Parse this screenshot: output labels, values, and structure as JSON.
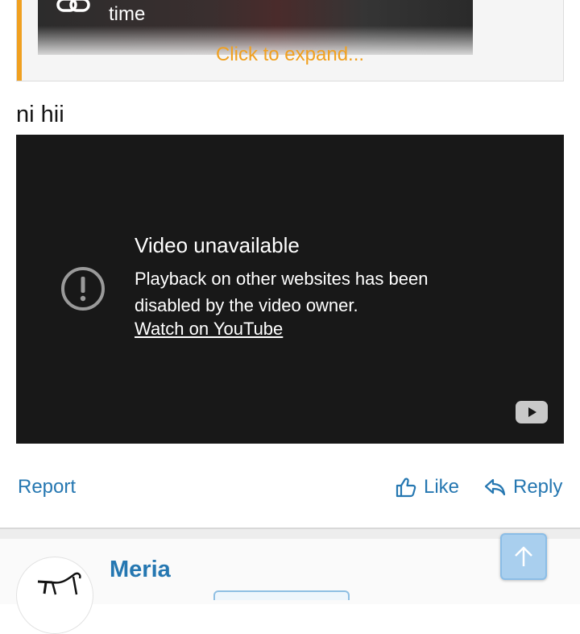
{
  "quote": {
    "embed_text": "time",
    "link_icon": "link-icon",
    "expand_label": "Click to expand...",
    "accent_color": "#f0a020"
  },
  "post": {
    "text": "ni hii"
  },
  "video": {
    "title": "Video unavailable",
    "message": "Playback on other websites has been disabled by the video owner.",
    "link_label": "Watch on YouTube",
    "warning_icon": "exclamation-circle-icon",
    "logo_icon": "youtube-logo-icon"
  },
  "actions": {
    "report_label": "Report",
    "like_label": "Like",
    "reply_label": "Reply",
    "link_color": "#2577b1"
  },
  "next_post": {
    "username": "Meria",
    "avatar": "stick-figure-avatar"
  },
  "scroll_top": {
    "icon": "arrow-up-icon"
  }
}
